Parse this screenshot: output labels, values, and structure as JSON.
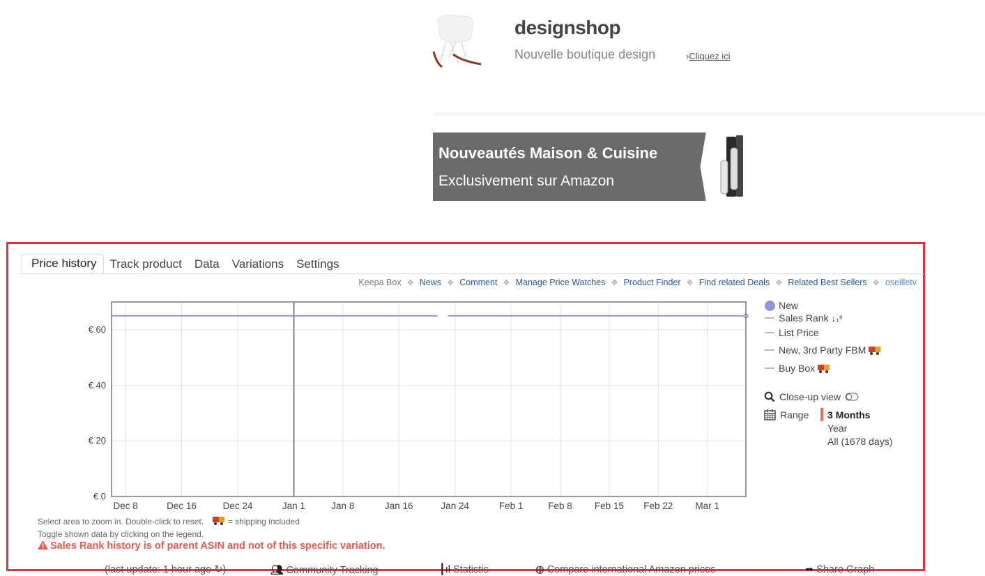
{
  "ad_designshop": {
    "title": "designshop",
    "subtitle": "Nouvelle boutique design",
    "link_prefix": "›",
    "link_label": "Cliquez ici"
  },
  "ad_banner": {
    "line1": "Nouveautés Maison & Cuisine",
    "line2": "Exclusivement sur Amazon"
  },
  "keepa": {
    "tabs": [
      {
        "label": "Price history",
        "active": true
      },
      {
        "label": "Track product",
        "active": false
      },
      {
        "label": "Data",
        "active": false
      },
      {
        "label": "Variations",
        "active": false
      },
      {
        "label": "Settings",
        "active": false
      }
    ],
    "links": {
      "keepa_box": "Keepa Box",
      "items": [
        "News",
        "Comment",
        "Manage Price Watches",
        "Product Finder",
        "Find related Deals",
        "Related Best Sellers"
      ],
      "user": "oseilletv",
      "separator": "✥"
    },
    "legend": [
      {
        "label": "New",
        "marker": "dot",
        "color": "#8f96dc",
        "shipping_icon": false
      },
      {
        "label": "Sales Rank",
        "marker": "dash",
        "suffix": "↓₁⁹",
        "shipping_icon": false
      },
      {
        "label": "List Price",
        "marker": "dash",
        "shipping_icon": false
      },
      {
        "label": "New, 3rd Party FBM",
        "marker": "dash",
        "shipping_icon": true
      },
      {
        "label": "Buy Box",
        "marker": "dash",
        "shipping_icon": true
      }
    ],
    "closeup_label": "Close-up view",
    "range": {
      "label": "Range",
      "options": [
        "3 Months",
        "Year",
        "All (1678 days)"
      ],
      "selected": "3 Months",
      "accent": "#ef6c55"
    },
    "notes": {
      "zoom_hint": "Select area to zoom in. Double-click to reset.",
      "shipping_hint": "= shipping included",
      "toggle_hint": "Toggle shown data by clicking on the legend."
    },
    "warning": "Sales Rank history is of parent ASIN and not of this specific variation.",
    "bottom": {
      "last_update": "(last update: 1 hour ago ↻)",
      "community": "Community Tracking",
      "statistic": "Statistic",
      "compare": "Compare international Amazon prices",
      "share": "Share Graph"
    }
  },
  "chart_data": {
    "type": "line",
    "title": "",
    "xlabel": "",
    "ylabel": "",
    "y_tick_labels": [
      "€ 0",
      "€ 20",
      "€ 40",
      "€ 60"
    ],
    "y_ticks": [
      0,
      20,
      40,
      60
    ],
    "ylim": [
      0,
      70
    ],
    "x_tick_labels": [
      "Dec 8",
      "Dec 16",
      "Dec 24",
      "Jan 1",
      "Jan 8",
      "Jan 16",
      "Jan 24",
      "Feb 1",
      "Feb 8",
      "Feb 15",
      "Feb 22",
      "Mar 1"
    ],
    "x_ticks_day": [
      2,
      10,
      18,
      26,
      33,
      41,
      49,
      57,
      64,
      71,
      78,
      85
    ],
    "xlim_day": [
      0,
      90.5
    ],
    "x_day_origin": "Dec 6",
    "highlight_x_day": 26,
    "grid": true,
    "legend_position": "right",
    "series": [
      {
        "name": "New",
        "color": "#8f96dc",
        "segments": [
          {
            "x_day": [
              0,
              46.5
            ],
            "y": [
              65,
              65
            ]
          },
          {
            "x_day": [
              48,
              90.5
            ],
            "y": [
              65,
              65
            ]
          }
        ],
        "end_marker": true
      }
    ]
  }
}
